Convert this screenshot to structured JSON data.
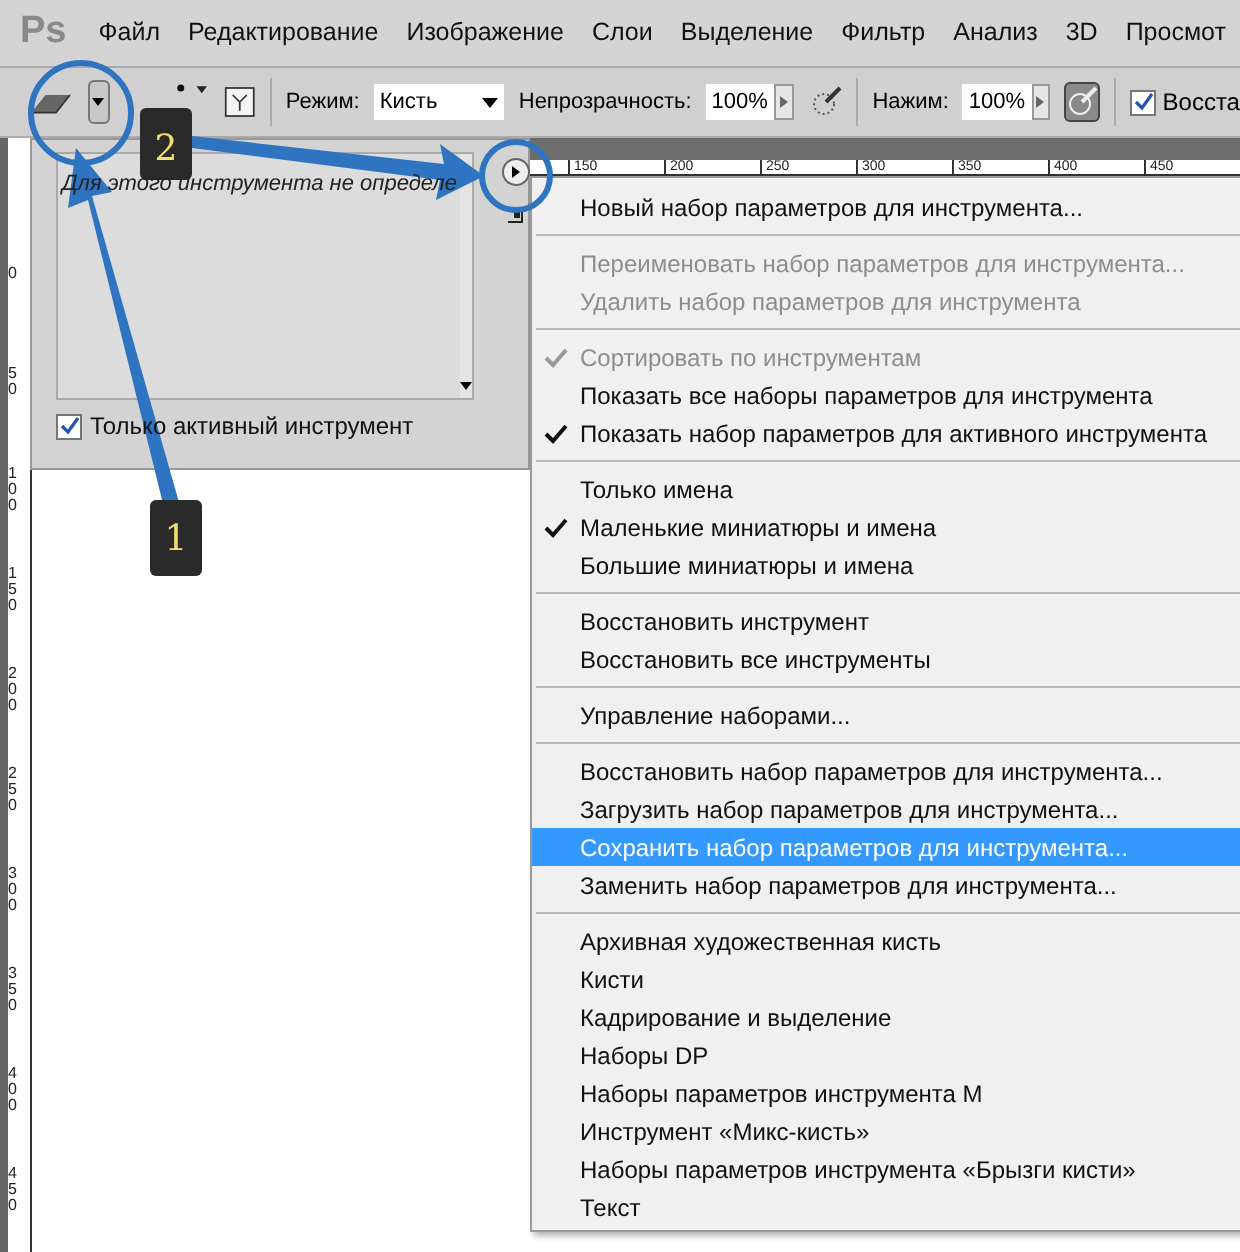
{
  "menu_bar": {
    "logo": "Ps",
    "items": [
      "Файл",
      "Редактирование",
      "Изображение",
      "Слои",
      "Выделение",
      "Фильтр",
      "Анализ",
      "3D",
      "Просмот"
    ]
  },
  "options_bar": {
    "mode_label": "Режим:",
    "mode_value": "Кисть",
    "opacity_label": "Непрозрачность:",
    "opacity_value": "100%",
    "airbrush_on": false,
    "flow_label": "Нажим:",
    "flow_value": "100%",
    "pressure_on": true,
    "restore": {
      "label": "Восста",
      "checked": true
    }
  },
  "top_ruler": [
    "150",
    "200",
    "250",
    "300",
    "350",
    "400",
    "450"
  ],
  "left_ruler": [
    "0",
    "50",
    "100",
    "150",
    "200",
    "250",
    "300",
    "350",
    "400",
    "450"
  ],
  "presets_panel": {
    "message": "Для этого инструмента не определе",
    "only_active": {
      "label": "Только активный инструмент",
      "checked": true
    }
  },
  "flyout_menu": {
    "items": [
      {
        "kind": "item",
        "label": "Новый набор параметров для инструмента...",
        "checked": false,
        "disabled": false,
        "selected": false
      },
      {
        "kind": "separator"
      },
      {
        "kind": "item",
        "label": "Переименовать набор параметров для инструмента...",
        "checked": false,
        "disabled": true,
        "selected": false
      },
      {
        "kind": "item",
        "label": "Удалить набор параметров для инструмента",
        "checked": false,
        "disabled": true,
        "selected": false
      },
      {
        "kind": "separator"
      },
      {
        "kind": "item",
        "label": "Сортировать по инструментам",
        "checked": true,
        "disabled": true,
        "selected": false
      },
      {
        "kind": "item",
        "label": "Показать все наборы параметров для инструмента",
        "checked": false,
        "disabled": false,
        "selected": false
      },
      {
        "kind": "item",
        "label": "Показать набор параметров для активного инструмента",
        "checked": true,
        "disabled": false,
        "selected": false
      },
      {
        "kind": "separator"
      },
      {
        "kind": "item",
        "label": "Только имена",
        "checked": false,
        "disabled": false,
        "selected": false
      },
      {
        "kind": "item",
        "label": "Маленькие миниатюры и имена",
        "checked": true,
        "disabled": false,
        "selected": false
      },
      {
        "kind": "item",
        "label": "Большие миниатюры и имена",
        "checked": false,
        "disabled": false,
        "selected": false
      },
      {
        "kind": "separator"
      },
      {
        "kind": "item",
        "label": "Восстановить инструмент",
        "checked": false,
        "disabled": false,
        "selected": false
      },
      {
        "kind": "item",
        "label": "Восстановить все инструменты",
        "checked": false,
        "disabled": false,
        "selected": false
      },
      {
        "kind": "separator"
      },
      {
        "kind": "item",
        "label": "Управление наборами...",
        "checked": false,
        "disabled": false,
        "selected": false
      },
      {
        "kind": "separator"
      },
      {
        "kind": "item",
        "label": "Восстановить набор параметров для инструмента...",
        "checked": false,
        "disabled": false,
        "selected": false
      },
      {
        "kind": "item",
        "label": "Загрузить набор параметров для инструмента...",
        "checked": false,
        "disabled": false,
        "selected": false
      },
      {
        "kind": "item",
        "label": "Сохранить набор параметров для инструмента...",
        "checked": false,
        "disabled": false,
        "selected": true
      },
      {
        "kind": "item",
        "label": "Заменить набор параметров для инструмента...",
        "checked": false,
        "disabled": false,
        "selected": false
      },
      {
        "kind": "separator"
      },
      {
        "kind": "item",
        "label": "Архивная художественная кисть",
        "checked": false,
        "disabled": false,
        "selected": false
      },
      {
        "kind": "item",
        "label": "Кисти",
        "checked": false,
        "disabled": false,
        "selected": false
      },
      {
        "kind": "item",
        "label": "Кадрирование и выделение",
        "checked": false,
        "disabled": false,
        "selected": false
      },
      {
        "kind": "item",
        "label": "Наборы DP",
        "checked": false,
        "disabled": false,
        "selected": false
      },
      {
        "kind": "item",
        "label": "Наборы параметров инструмента M",
        "checked": false,
        "disabled": false,
        "selected": false
      },
      {
        "kind": "item",
        "label": "Инструмент «Микс-кисть»",
        "checked": false,
        "disabled": false,
        "selected": false
      },
      {
        "kind": "item",
        "label": "Наборы параметров инструмента  «Брызги кисти»",
        "checked": false,
        "disabled": false,
        "selected": false
      },
      {
        "kind": "item",
        "label": "Текст",
        "checked": false,
        "disabled": false,
        "selected": false
      }
    ]
  },
  "annotations": [
    {
      "label": "1"
    },
    {
      "label": "2"
    }
  ]
}
